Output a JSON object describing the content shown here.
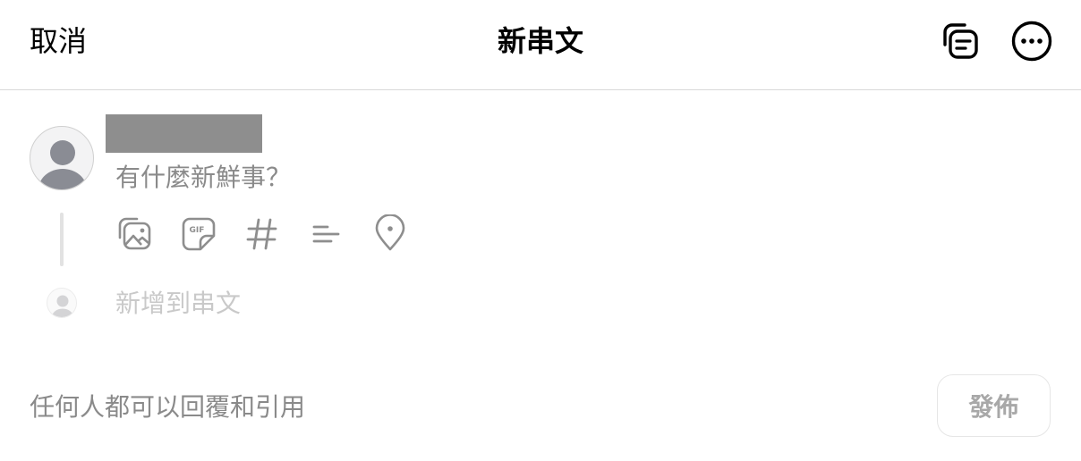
{
  "header": {
    "cancel_label": "取消",
    "title": "新串文",
    "drafts_icon": "drafts-icon",
    "more_icon": "more-options-icon"
  },
  "composer": {
    "placeholder": "有什麼新鮮事？",
    "value": "",
    "tools": [
      {
        "name": "image-gallery-icon"
      },
      {
        "name": "gif-icon"
      },
      {
        "name": "hashtag-icon"
      },
      {
        "name": "poll-icon"
      },
      {
        "name": "location-icon"
      }
    ]
  },
  "add_thread": {
    "label": "新增到串文"
  },
  "footer": {
    "reply_setting": "任何人都可以回覆和引用",
    "post_label": "發佈"
  },
  "colors": {
    "placeholder": "#8a8a8a",
    "disabled_text": "#c9c9c9",
    "post_disabled": "#a8a8a8",
    "divider": "#d9d9d9",
    "icon_gray": "#8e8e8e"
  }
}
